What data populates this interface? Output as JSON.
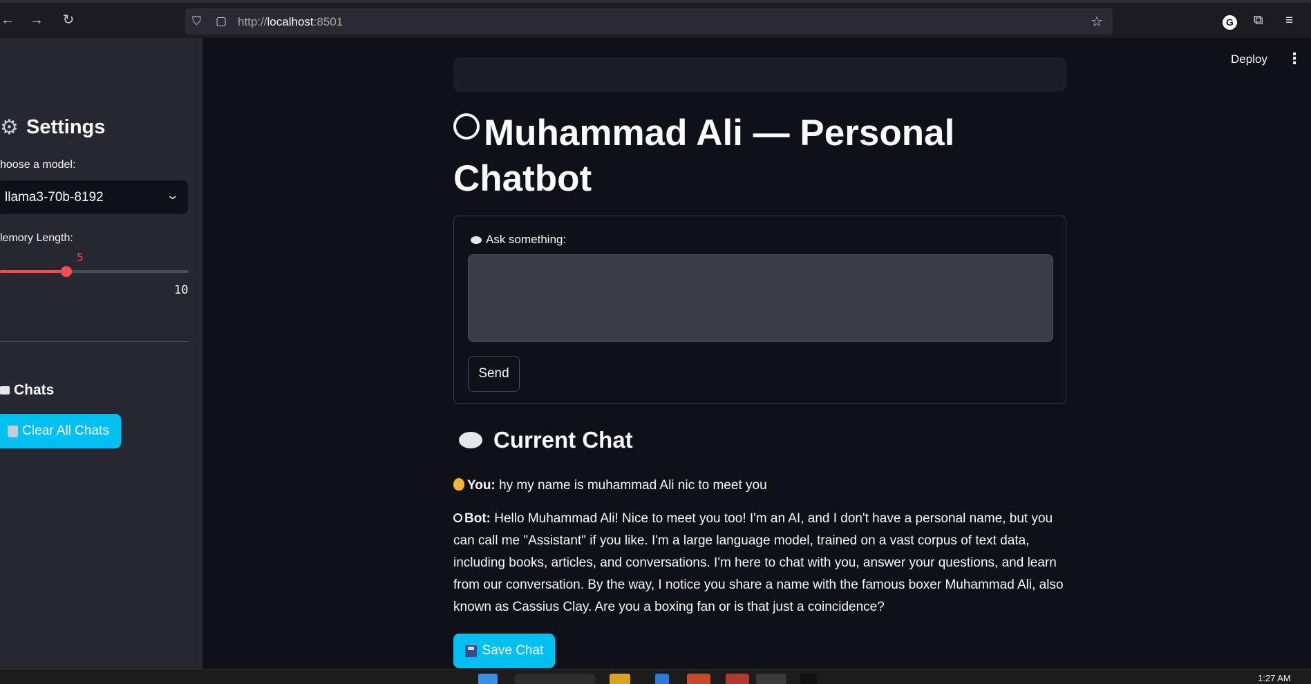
{
  "browser": {
    "url_prefix": "http://",
    "url_host": "localhost",
    "url_port": ":8501"
  },
  "header": {
    "deploy_label": "Deploy",
    "menu_icon": "vertical-dots-icon"
  },
  "sidebar": {
    "title": "Settings",
    "model_label": "hoose a model:",
    "model_value": "llama3-70b-8192",
    "memory_label": "lemory Length:",
    "memory_value": "5",
    "memory_max": "10",
    "memory_fraction": 0.35,
    "chats_heading": "Chats",
    "clear_button": "Clear All Chats"
  },
  "main": {
    "title": "Muhammad Ali — Personal Chatbot",
    "input_label": "Ask something:",
    "input_value": "",
    "send_button": "Send",
    "current_chat_heading": "Current Chat",
    "messages": [
      {
        "speaker": "You:",
        "text": " hy my name is muhammad Ali nic to meet you"
      },
      {
        "speaker": "Bot:",
        "text": " Hello Muhammad Ali! Nice to meet you too! I'm an AI, and I don't have a personal name, but you can call me \"Assistant\" if you like. I'm a large language model, trained on a vast corpus of text data, including books, articles, and conversations. I'm here to chat with you, answer your questions, and learn from our conversation. By the way, I notice you share a name with the famous boxer Muhammad Ali, also known as Cassius Clay. Are you a boxing fan or is that just a coincidence?"
      }
    ],
    "save_button": "Save Chat"
  },
  "taskbar": {
    "clock": "1:27 AM"
  },
  "colors": {
    "accent": "#00c0f2",
    "slider": "#ff4b4b",
    "background": "#0e1117",
    "sidebar": "#262730"
  }
}
